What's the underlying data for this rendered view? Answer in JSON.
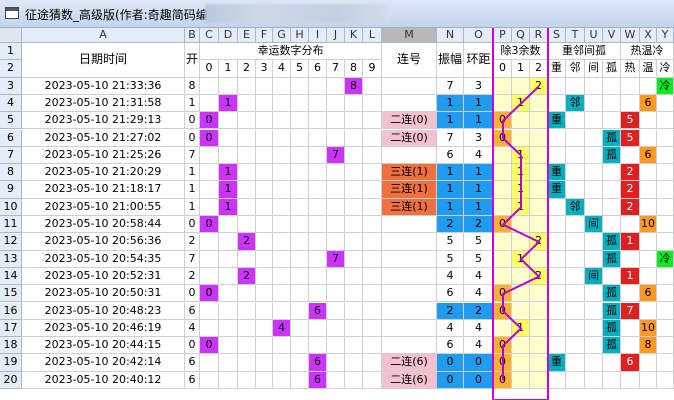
{
  "window": {
    "title": "征途猜数_高级版(作者:奇趣简码编程"
  },
  "sheet": {
    "col_letters": [
      "A",
      "B",
      "C",
      "D",
      "E",
      "F",
      "G",
      "H",
      "I",
      "J",
      "K",
      "L",
      "M",
      "N",
      "O",
      "P",
      "Q",
      "R",
      "S",
      "T",
      "U",
      "V",
      "W",
      "X",
      "Y"
    ],
    "row_numbers": [
      "1",
      "2",
      "3",
      "4",
      "5",
      "6",
      "7",
      "8",
      "9",
      "10",
      "11",
      "12",
      "13",
      "14",
      "15",
      "16",
      "17",
      "18",
      "19",
      "20"
    ],
    "headers": {
      "datetime": "日期时间",
      "open": "开",
      "lucky_dist": "幸运数字分布",
      "lucky_digits": [
        "0",
        "1",
        "2",
        "3",
        "4",
        "5",
        "6",
        "7",
        "8",
        "9"
      ],
      "lianhao": "连号",
      "amplitude": "振幅",
      "ring_dist": "环距",
      "mod3": "除3余数",
      "mod3_digits": [
        "0",
        "1",
        "2"
      ],
      "repeat_group": "重邻间孤",
      "repeat_labels": [
        "重",
        "邻",
        "间",
        "孤"
      ],
      "heat_group": "热温冷",
      "heat_labels": [
        "热",
        "温",
        "冷"
      ]
    },
    "rows": [
      {
        "dt": "2023-05-10 21:33:36",
        "v": "8",
        "lian": "",
        "amp": "7",
        "ring": "3",
        "rep": "",
        "heat": "冷",
        "heat_col": 2
      },
      {
        "dt": "2023-05-10 21:31:58",
        "v": "1",
        "lian": "",
        "amp": "1",
        "ring": "1",
        "rep": "邻",
        "heat": "6",
        "heat_col": 1
      },
      {
        "dt": "2023-05-10 21:29:13",
        "v": "0",
        "lian": "二连(0)",
        "amp": "1",
        "ring": "1",
        "rep": "重",
        "heat": "5",
        "heat_col": 0
      },
      {
        "dt": "2023-05-10 21:27:02",
        "v": "0",
        "lian": "二连(0)",
        "amp": "7",
        "ring": "3",
        "rep": "孤",
        "heat": "5",
        "heat_col": 0
      },
      {
        "dt": "2023-05-10 21:25:26",
        "v": "7",
        "lian": "",
        "amp": "6",
        "ring": "4",
        "rep": "孤",
        "heat": "6",
        "heat_col": 1
      },
      {
        "dt": "2023-05-10 21:20:29",
        "v": "1",
        "lian": "三连(1)",
        "amp": "1",
        "ring": "1",
        "rep": "重",
        "heat": "2",
        "heat_col": 0
      },
      {
        "dt": "2023-05-10 21:18:17",
        "v": "1",
        "lian": "三连(1)",
        "amp": "1",
        "ring": "1",
        "rep": "重",
        "heat": "2",
        "heat_col": 0
      },
      {
        "dt": "2023-05-10 21:00:55",
        "v": "1",
        "lian": "三连(1)",
        "amp": "1",
        "ring": "1",
        "rep": "邻",
        "heat": "2",
        "heat_col": 0
      },
      {
        "dt": "2023-05-10 20:58:44",
        "v": "0",
        "lian": "",
        "amp": "2",
        "ring": "2",
        "rep": "间",
        "heat": "10",
        "heat_col": 1
      },
      {
        "dt": "2023-05-10 20:56:36",
        "v": "2",
        "lian": "",
        "amp": "5",
        "ring": "5",
        "rep": "孤",
        "heat": "1",
        "heat_col": 0
      },
      {
        "dt": "2023-05-10 20:54:35",
        "v": "7",
        "lian": "",
        "amp": "5",
        "ring": "5",
        "rep": "孤",
        "heat": "冷",
        "heat_col": 2
      },
      {
        "dt": "2023-05-10 20:52:31",
        "v": "2",
        "lian": "",
        "amp": "4",
        "ring": "4",
        "rep": "间",
        "heat": "1",
        "heat_col": 0
      },
      {
        "dt": "2023-05-10 20:50:31",
        "v": "0",
        "lian": "",
        "amp": "6",
        "ring": "4",
        "rep": "孤",
        "heat": "6",
        "heat_col": 1
      },
      {
        "dt": "2023-05-10 20:48:23",
        "v": "6",
        "lian": "",
        "amp": "2",
        "ring": "2",
        "rep": "孤",
        "heat": "7",
        "heat_col": 0
      },
      {
        "dt": "2023-05-10 20:46:19",
        "v": "4",
        "lian": "",
        "amp": "4",
        "ring": "4",
        "rep": "孤",
        "heat": "10",
        "heat_col": 1
      },
      {
        "dt": "2023-05-10 20:44:15",
        "v": "0",
        "lian": "",
        "amp": "6",
        "ring": "4",
        "rep": "孤",
        "heat": "8",
        "heat_col": 1
      },
      {
        "dt": "2023-05-10 20:42:14",
        "v": "6",
        "lian": "二连(6)",
        "amp": "0",
        "ring": "0",
        "rep": "重",
        "heat": "6",
        "heat_col": 0
      },
      {
        "dt": "2023-05-10 20:40:12",
        "v": "6",
        "lian": "二连(6)",
        "amp": "0",
        "ring": "0",
        "rep": "",
        "heat": "",
        "heat_col": 0
      }
    ]
  },
  "colors": {
    "purple": "#cc33ff",
    "pink": "#f3c1d0",
    "orange_red": "#f07040",
    "blue": "#1f9bf0",
    "yellow": "#ffff66",
    "orange": "#ffb030",
    "teal": "#00b0c0",
    "red": "#e02020",
    "amber": "#ff9922",
    "green": "#00ee22",
    "magenta_box": "#d000d8"
  }
}
